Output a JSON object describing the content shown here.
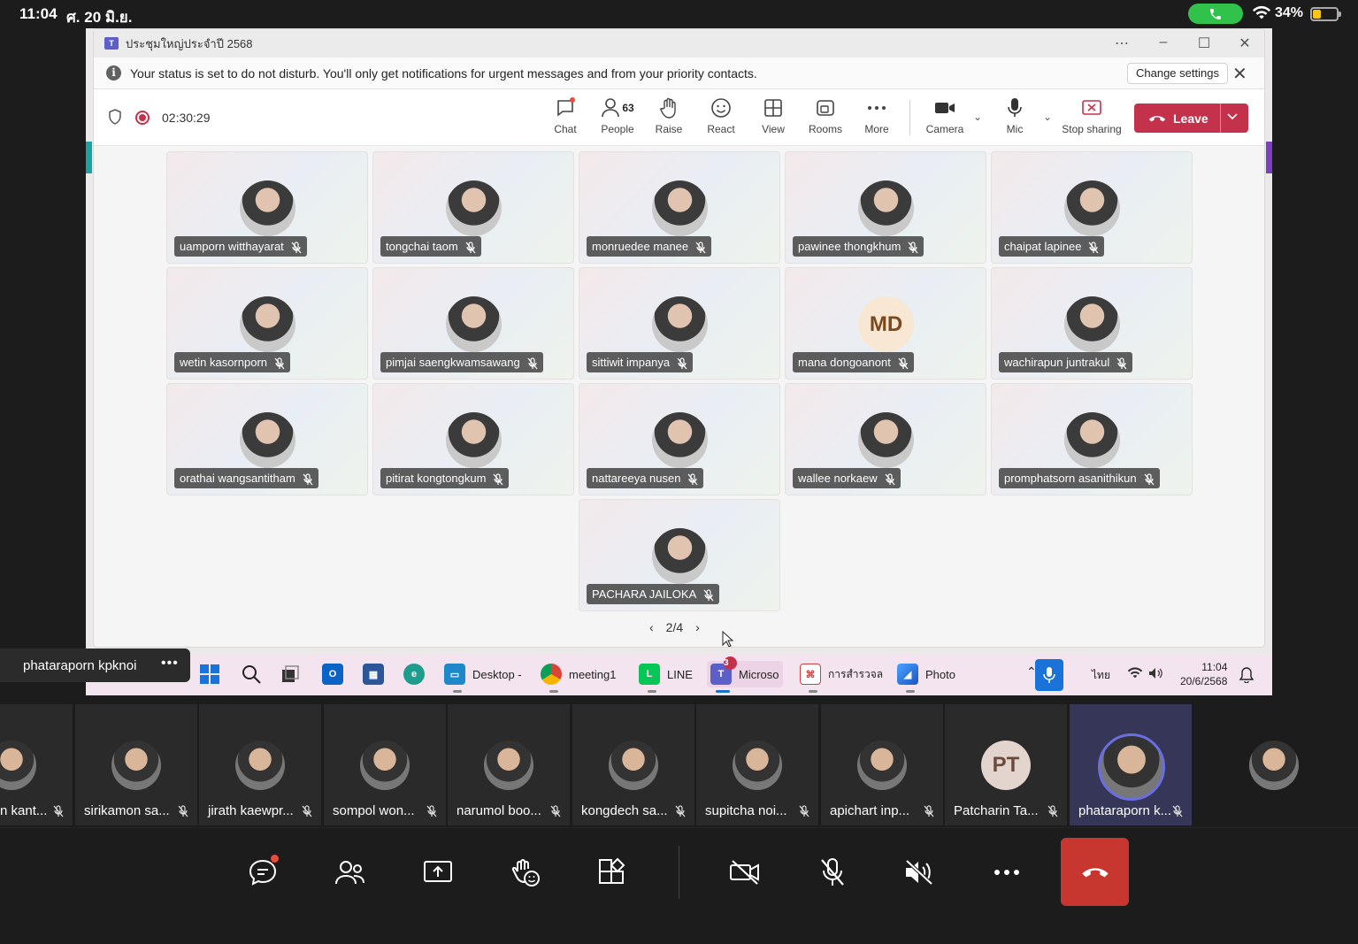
{
  "ios_status": {
    "time": "11:04",
    "date": "ศ. 20 มิ.ย.",
    "battery_pct": "34%",
    "battery_level": 0.34
  },
  "window": {
    "title": "ประชุมใหญ่ประจำปี 2568"
  },
  "notice": {
    "text": "Your status is set to do not disturb. You'll only get notifications for urgent messages and from your priority contacts.",
    "change_label": "Change settings"
  },
  "meeting": {
    "timer": "02:30:29",
    "people_count": "63",
    "toolbar": {
      "chat": "Chat",
      "people": "People",
      "raise": "Raise",
      "react": "React",
      "view": "View",
      "rooms": "Rooms",
      "more": "More",
      "camera": "Camera",
      "mic": "Mic",
      "stop_sharing": "Stop sharing",
      "leave": "Leave"
    }
  },
  "gallery": [
    {
      "name": "uamporn witthayarat"
    },
    {
      "name": "tongchai taom"
    },
    {
      "name": "monruedee manee"
    },
    {
      "name": "pawinee thongkhum"
    },
    {
      "name": "chaipat lapinee"
    },
    {
      "name": "wetin kasornporn"
    },
    {
      "name": "pimjai saengkwamsawang"
    },
    {
      "name": "sittiwit impanya"
    },
    {
      "name": "mana dongoanont",
      "initials": "MD"
    },
    {
      "name": "wachirapun juntrakul"
    },
    {
      "name": "orathai wangsantitham"
    },
    {
      "name": "pitirat kongtongkum"
    },
    {
      "name": "nattareeya nusen"
    },
    {
      "name": "wallee norkaew"
    },
    {
      "name": "promphatsorn asanithikun"
    },
    {
      "name": "PACHARA JAILOKA"
    }
  ],
  "pager": {
    "label": "2/4"
  },
  "taskbar": {
    "desktop": "Desktop -",
    "chrome": "meeting1",
    "line": "LINE",
    "teams": "Microso",
    "teams_badge": "3",
    "pdf": "การสำรวจล",
    "photos": "Photo",
    "lang": "ไทย",
    "time": "11:04",
    "date": "20/6/2568"
  },
  "presenter_name": "phataraporn kpknoi",
  "participants": [
    {
      "name": "n kant..."
    },
    {
      "name": "sirikamon sa..."
    },
    {
      "name": "jirath kaewpr..."
    },
    {
      "name": "sompol won..."
    },
    {
      "name": "narumol boo..."
    },
    {
      "name": "kongdech sa..."
    },
    {
      "name": "supitcha noi..."
    },
    {
      "name": "apichart inp..."
    },
    {
      "name": "Patcharin Ta...",
      "initials": "PT"
    },
    {
      "name": "phataraporn k..."
    }
  ],
  "colors": {
    "leave_red": "#c4314b",
    "hangup_red": "#c8372f",
    "active_tile": "#363658",
    "teams_purple": "#5b5fc7"
  }
}
